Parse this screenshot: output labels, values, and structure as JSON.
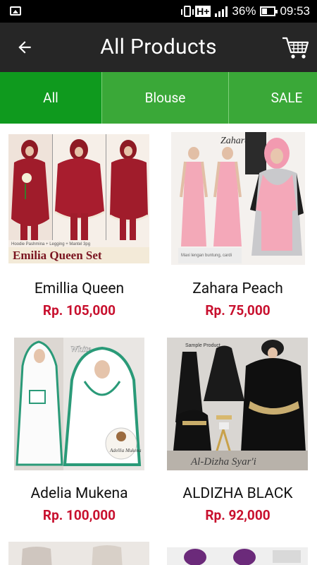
{
  "status_bar": {
    "network": "H+",
    "battery": "36%",
    "time": "09:53"
  },
  "app_bar": {
    "title": "All Products",
    "back_icon": "arrow-left-icon",
    "cart_icon": "shopping-cart-icon"
  },
  "tabs": [
    {
      "label": "All",
      "active": true
    },
    {
      "label": "Blouse",
      "active": false
    },
    {
      "label": "SALE",
      "active": false
    }
  ],
  "products": [
    {
      "name": "Emillia Queen",
      "price": "Rp. 105,000",
      "image_caption": "Emilia Queen Set"
    },
    {
      "name": "Zahara Peach",
      "price": "Rp. 75,000",
      "image_caption": "Zahara"
    },
    {
      "name": "Adelia Mukena",
      "price": "Rp. 100,000",
      "image_caption": "Adellia Mukena"
    },
    {
      "name": "ALDIZHA BLACK",
      "price": "Rp. 92,000",
      "image_caption": "Al-Dizha Syar'i"
    }
  ],
  "colors": {
    "tab_bar": "#3aa838",
    "tab_active": "#0f9a1e",
    "app_bar": "#262626",
    "price": "#c8102e"
  }
}
